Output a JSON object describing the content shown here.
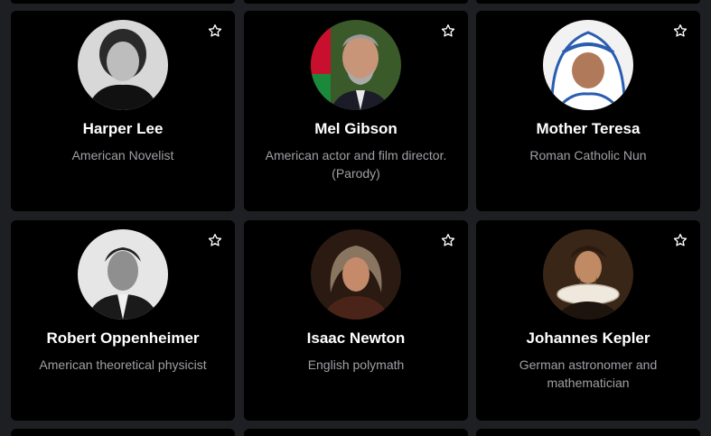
{
  "people": [
    {
      "name": "Harper Lee",
      "description": "American Novelist",
      "avatar": "harper-lee-portrait"
    },
    {
      "name": "Mel Gibson",
      "description": "American actor and film director. (Parody)",
      "avatar": "mel-gibson-portrait"
    },
    {
      "name": "Mother Teresa",
      "description": "Roman Catholic Nun",
      "avatar": "mother-teresa-portrait"
    },
    {
      "name": "Robert Oppenheimer",
      "description": "American theoretical physicist",
      "avatar": "robert-oppenheimer-portrait"
    },
    {
      "name": "Isaac Newton",
      "description": "English polymath",
      "avatar": "isaac-newton-portrait"
    },
    {
      "name": "Johannes Kepler",
      "description": "German astronomer and mathematician",
      "avatar": "johannes-kepler-portrait"
    }
  ],
  "icons": {
    "favorite": "star-outline-icon"
  },
  "colors": {
    "page_bg": "#1e1f22",
    "card_bg": "#000000",
    "name": "#ffffff",
    "description": "#9ea0a5"
  }
}
